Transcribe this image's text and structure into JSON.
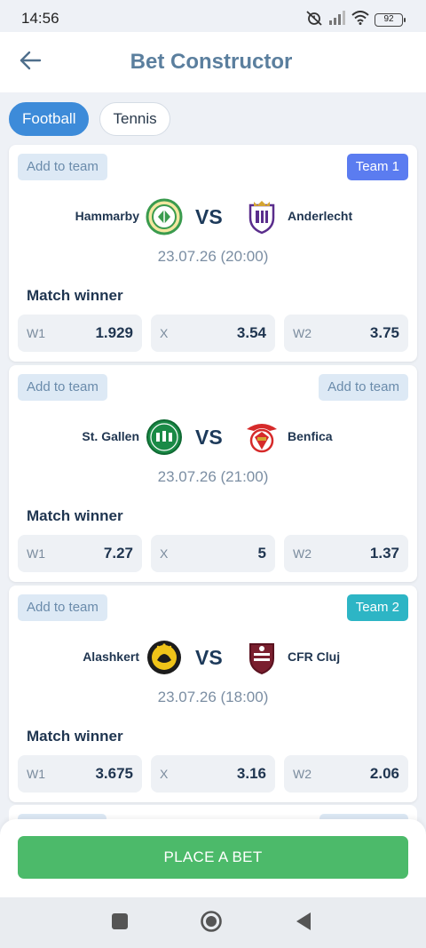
{
  "status_bar": {
    "time": "14:56",
    "battery": "92",
    "icons": [
      "alarm-off-icon",
      "signal-icon",
      "wifi-icon",
      "battery-icon"
    ]
  },
  "header": {
    "title": "Bet Constructor",
    "back_icon": "arrow-left-icon"
  },
  "sport_tabs": [
    {
      "label": "Football",
      "active": true
    },
    {
      "label": "Tennis",
      "active": false
    }
  ],
  "matches": [
    {
      "left_action": "Add to team",
      "right_action": "Team 1",
      "home": "Hammarby",
      "vs": "VS",
      "away": "Anderlecht",
      "datetime": "23.07.26 (20:00)",
      "market": "Match winner",
      "odds": [
        {
          "label": "W1",
          "value": "1.929"
        },
        {
          "label": "X",
          "value": "3.54"
        },
        {
          "label": "W2",
          "value": "3.75"
        }
      ]
    },
    {
      "left_action": "Add to team",
      "right_action": "Add to team",
      "home": "St. Gallen",
      "vs": "VS",
      "away": "Benfica",
      "datetime": "23.07.26 (21:00)",
      "market": "Match winner",
      "odds": [
        {
          "label": "W1",
          "value": "7.27"
        },
        {
          "label": "X",
          "value": "5"
        },
        {
          "label": "W2",
          "value": "1.37"
        }
      ]
    },
    {
      "left_action": "Add to team",
      "right_action": "Team 2",
      "home": "Alashkert",
      "vs": "VS",
      "away": "CFR Cluj",
      "datetime": "23.07.26 (18:00)",
      "market": "Match winner",
      "odds": [
        {
          "label": "W1",
          "value": "3.675"
        },
        {
          "label": "X",
          "value": "3.16"
        },
        {
          "label": "W2",
          "value": "2.06"
        }
      ]
    }
  ],
  "colors": {
    "accent": "#3d8bd9",
    "team1": "#5b7cf0",
    "team2": "#2db5c5",
    "place_bet": "#4cba6a"
  },
  "footer": {
    "place_bet_label": "PLACE A BET"
  },
  "nav": [
    "recent-apps-icon",
    "home-icon",
    "back-icon"
  ]
}
